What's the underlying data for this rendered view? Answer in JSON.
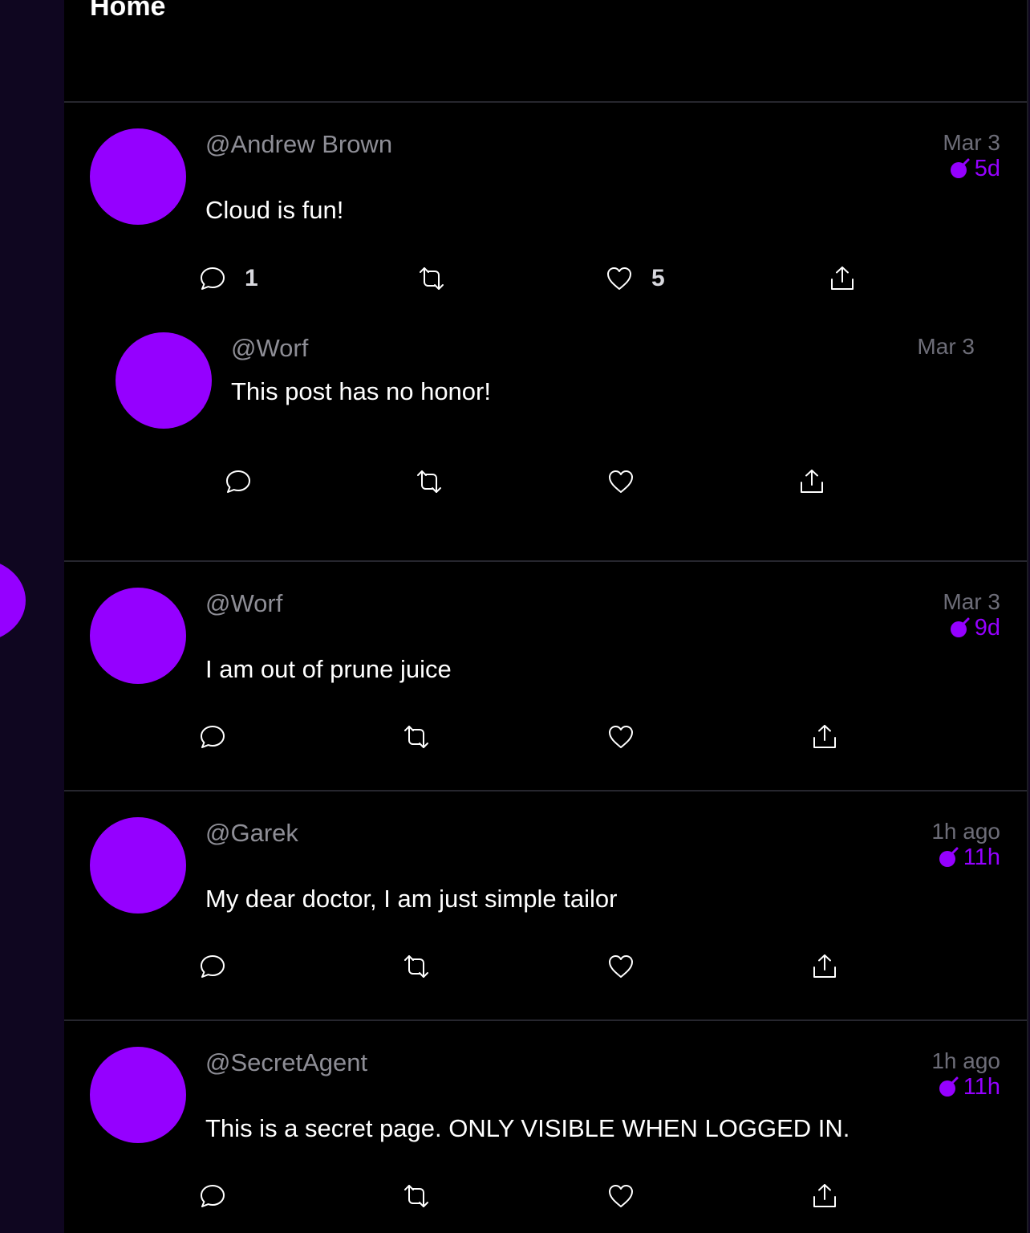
{
  "page": {
    "title": "Home"
  },
  "colors": {
    "accent": "#9500ff",
    "background": "#000000",
    "sidebar": "#0f0620",
    "divider": "#26262e",
    "muted": "#8e8e96"
  },
  "icons": {
    "reply": "reply-bubble-icon",
    "repost": "repost-icon",
    "like": "heart-icon",
    "share": "share-icon",
    "expiry": "bomb-icon"
  },
  "posts": [
    {
      "handle": "@Andrew Brown",
      "message": "Cloud is fun!",
      "date": "Mar 3",
      "expires": "5d",
      "reply_count": "1",
      "like_count": "5",
      "replies": [
        {
          "handle": "@Worf",
          "message": "This post has no honor!",
          "date": "Mar 3"
        }
      ]
    },
    {
      "handle": "@Worf",
      "message": "I am out of prune juice",
      "date": "Mar 3",
      "expires": "9d"
    },
    {
      "handle": "@Garek",
      "message": "My dear doctor, I am just simple tailor",
      "date": "1h ago",
      "expires": "11h"
    },
    {
      "handle": "@SecretAgent",
      "message": "This is a secret page. ONLY VISIBLE WHEN LOGGED IN.",
      "date": "1h ago",
      "expires": "11h"
    }
  ]
}
